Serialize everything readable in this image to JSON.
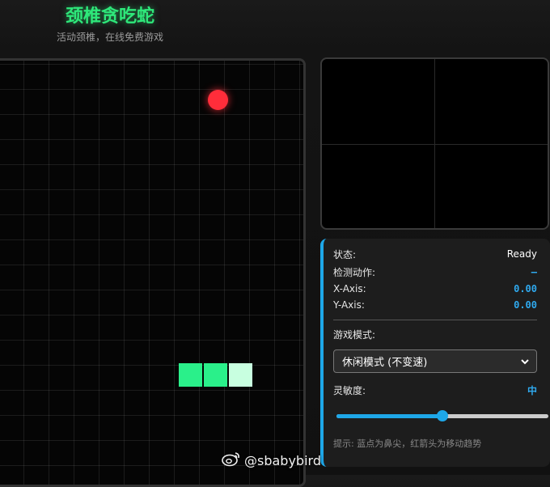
{
  "header": {
    "title": "颈椎贪吃蛇",
    "subtitle": "活动颈椎，在线免费游戏"
  },
  "game": {
    "snake_segments": [
      "body",
      "body",
      "head"
    ]
  },
  "status_panel": {
    "status_label": "状态:",
    "status_value": "Ready",
    "action_label": "检测动作:",
    "action_value": "–",
    "x_label": "X-Axis:",
    "x_value": "0.00",
    "y_label": "Y-Axis:",
    "y_value": "0.00",
    "mode_label": "游戏模式:",
    "mode_selected": "休闲模式 (不变速)",
    "sensitivity_label": "灵敏度:",
    "sensitivity_value": "中",
    "sensitivity_level": 0.5,
    "hint": "提示: 蓝点为鼻尖，红箭头为移动趋势"
  },
  "watermark": {
    "text": "@sbabybird"
  },
  "colors": {
    "accent": "#1ea7e8",
    "snake": "#2af08a",
    "food": "#ff2d3a",
    "title": "#2ee87a"
  }
}
